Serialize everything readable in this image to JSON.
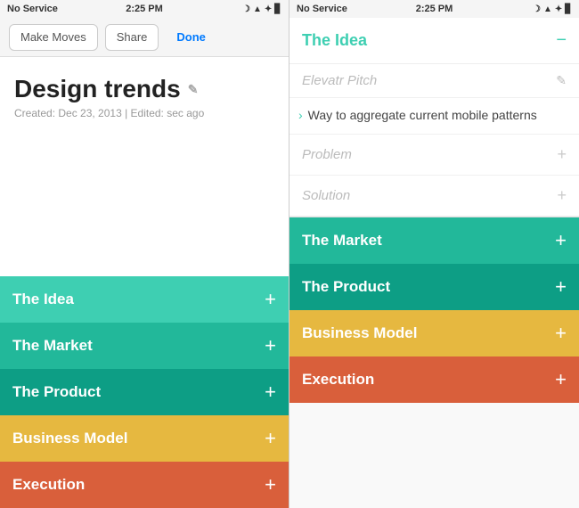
{
  "leftPanel": {
    "statusBar": {
      "left": "No Service",
      "center": "2:25 PM",
      "right": "icons"
    },
    "toolbar": {
      "makeMoves": "Make Moves",
      "share": "Share",
      "done": "Done"
    },
    "document": {
      "title": "Design trends",
      "meta": "Created: Dec 23, 2013 | Edited: sec ago"
    },
    "sections": [
      {
        "label": "The Idea",
        "colorClass": "row-idea"
      },
      {
        "label": "The Market",
        "colorClass": "row-market"
      },
      {
        "label": "The Product",
        "colorClass": "row-product"
      },
      {
        "label": "Business Model",
        "colorClass": "row-business"
      },
      {
        "label": "Execution",
        "colorClass": "row-execution"
      }
    ]
  },
  "rightPanel": {
    "statusBar": {
      "left": "No Service",
      "center": "2:25 PM",
      "right": "icons"
    },
    "expandedSection": {
      "title": "The Idea",
      "elevatorPitch": "Elevatr Pitch",
      "bulletText": "Way to aggregate current mobile patterns",
      "problem": "Problem",
      "solution": "Solution"
    },
    "sections": [
      {
        "label": "The Market",
        "colorClass": "row-market"
      },
      {
        "label": "The Product",
        "colorClass": "row-product"
      },
      {
        "label": "Business Model",
        "colorClass": "row-business"
      },
      {
        "label": "Execution",
        "colorClass": "row-execution"
      }
    ]
  }
}
